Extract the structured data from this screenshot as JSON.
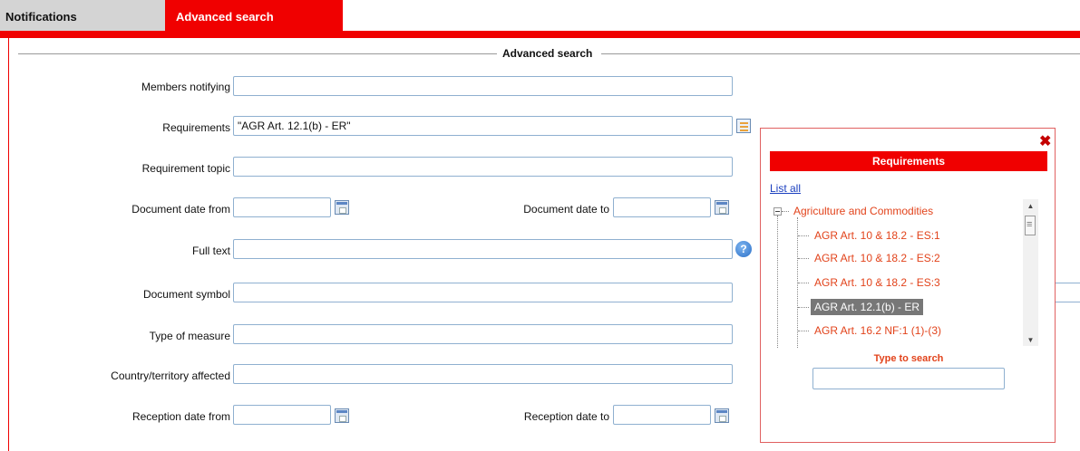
{
  "tabs": [
    {
      "label": "Notifications",
      "active": false
    },
    {
      "label": "Advanced search",
      "active": true
    }
  ],
  "fieldset_legend": "Advanced search",
  "form": {
    "members_notifying": {
      "label": "Members notifying",
      "value": ""
    },
    "requirements": {
      "label": "Requirements",
      "value": "\"AGR Art. 12.1(b) - ER\""
    },
    "requirement_topic": {
      "label": "Requirement topic",
      "value": ""
    },
    "document_date_from": {
      "label": "Document date from",
      "value": ""
    },
    "document_date_to": {
      "label": "Document date to",
      "value": ""
    },
    "full_text": {
      "label": "Full text",
      "value": ""
    },
    "document_symbol": {
      "label": "Document symbol",
      "value": ""
    },
    "type_of_measure": {
      "label": "Type of measure",
      "value": ""
    },
    "country_territory_affected": {
      "label": "Country/territory affected",
      "value": ""
    },
    "reception_date_from": {
      "label": "Reception date from",
      "value": ""
    },
    "reception_date_to": {
      "label": "Reception date to",
      "value": ""
    }
  },
  "popup": {
    "close_glyph": "✖",
    "title": "Requirements",
    "list_all": "List all",
    "tree": {
      "parent": "Agriculture and Commodities",
      "children": [
        {
          "label": "AGR Art. 10 & 18.2 - ES:1",
          "selected": false
        },
        {
          "label": "AGR Art. 10 & 18.2 - ES:2",
          "selected": false
        },
        {
          "label": "AGR Art. 10 & 18.2 - ES:3",
          "selected": false
        },
        {
          "label": "AGR Art. 12.1(b) - ER",
          "selected": true
        },
        {
          "label": "AGR Art. 16.2 NF:1 (1)-(3)",
          "selected": false
        }
      ]
    },
    "type_to_search_label": "Type to search",
    "type_to_search_value": ""
  },
  "help_glyph": "?",
  "colors": {
    "accent": "#f00000",
    "tree_text": "#e2431b",
    "link": "#1a3fbf"
  }
}
